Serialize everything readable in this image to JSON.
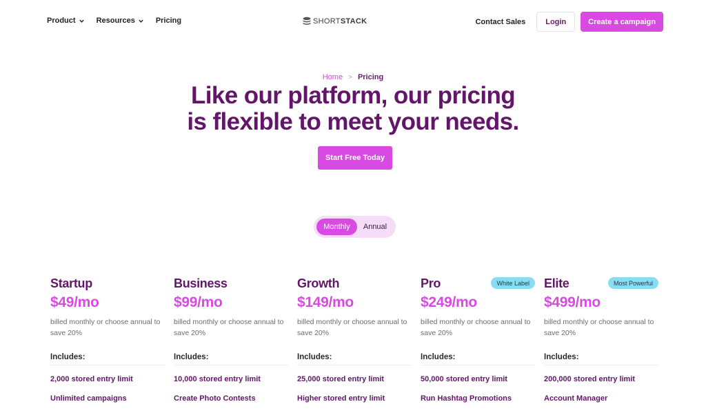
{
  "nav": {
    "items": [
      {
        "label": "Product",
        "dropdown": true
      },
      {
        "label": "Resources",
        "dropdown": true
      },
      {
        "label": "Pricing",
        "dropdown": false
      }
    ],
    "logo_thin": "SHORT",
    "logo_bold": "STACK",
    "contact_label": "Contact Sales",
    "login_label": "Login",
    "create_label": "Create a campaign"
  },
  "breadcrumb": {
    "home": "Home",
    "separator": ">",
    "current": "Pricing"
  },
  "hero": {
    "title": "Like our platform, our pricing is flexible to meet your needs.",
    "cta_label": "Start Free Today"
  },
  "billing_toggle": {
    "options": [
      "Monthly",
      "Annual"
    ],
    "selected": "Monthly"
  },
  "plans": [
    {
      "name": "Startup",
      "price": "$49/mo",
      "badge": "",
      "billing_note": "billed monthly or choose annual to save 20%",
      "includes_label": "Includes:",
      "features": [
        "2,000 stored entry limit",
        "Unlimited campaigns"
      ]
    },
    {
      "name": "Business",
      "price": "$99/mo",
      "badge": "",
      "billing_note": "billed monthly or choose annual to save 20%",
      "includes_label": "Includes:",
      "features": [
        "10,000 stored entry limit",
        "Create Photo Contests"
      ]
    },
    {
      "name": "Growth",
      "price": "$149/mo",
      "badge": "",
      "billing_note": "billed monthly or choose annual to save 20%",
      "includes_label": "Includes:",
      "features": [
        "25,000 stored entry limit",
        "Higher stored entry limit"
      ]
    },
    {
      "name": "Pro",
      "price": "$249/mo",
      "badge": "White Label",
      "billing_note": "billed monthly or choose annual to save 20%",
      "includes_label": "Includes:",
      "features": [
        "50,000 stored entry limit",
        "Run Hashtag Promotions"
      ]
    },
    {
      "name": "Elite",
      "price": "$499/mo",
      "badge": "Most Powerful",
      "billing_note": "billed monthly or choose annual to save 20%",
      "includes_label": "Includes:",
      "features": [
        "200,000 stored entry limit",
        "Account Manager"
      ]
    }
  ],
  "colors": {
    "brand_purple": "#621569",
    "accent_magenta": "#d94ae3",
    "badge_blue": "#8adcf3",
    "toggle_bg": "#f5dcf7"
  },
  "icons": {
    "dropdown": "chevron-down-icon",
    "logo": "stack-logo-icon"
  }
}
